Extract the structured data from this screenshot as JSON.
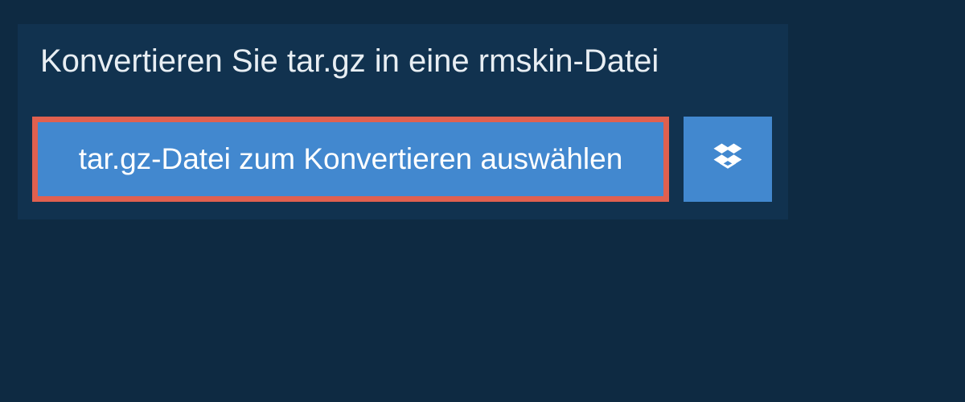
{
  "panel": {
    "title": "Konvertieren Sie tar.gz in eine rmskin-Datei",
    "file_select_label": "tar.gz-Datei zum Konvertieren auswählen"
  }
}
